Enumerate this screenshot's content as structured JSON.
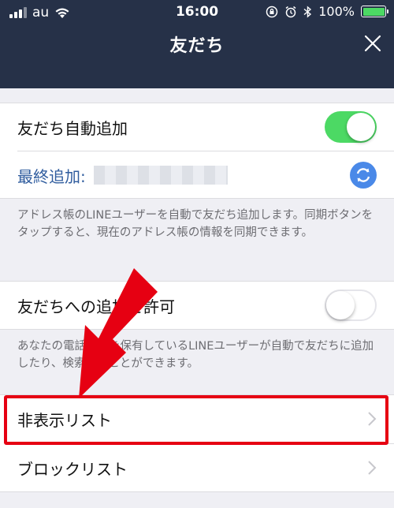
{
  "status_bar": {
    "carrier": "au",
    "time": "16:00",
    "battery_percent": "100%",
    "battery_color": "#4cd964"
  },
  "header": {
    "title": "友だち",
    "close_icon": "close-icon"
  },
  "auto_add": {
    "label": "友だち自動追加",
    "enabled": true,
    "last_added_label": "最終追加:",
    "sync_icon": "sync-icon",
    "description": "アドレス帳のLINEユーザーを自動で友だち追加します。同期ボタンをタップすると、現在のアドレス帳の情報を同期できます。"
  },
  "allow_add": {
    "label": "友だちへの追加を許可",
    "enabled": false,
    "description": "あなたの電話番号を保有しているLINEユーザーが自動で友だちに追加したり、検索することができます。"
  },
  "lists": {
    "hidden_list_label": "非表示リスト",
    "block_list_label": "ブロックリスト"
  },
  "colors": {
    "nav_background": "#263148",
    "toggle_on": "#4cd964",
    "accent_blue": "#4a89e8",
    "annotation_red": "#e60012"
  }
}
